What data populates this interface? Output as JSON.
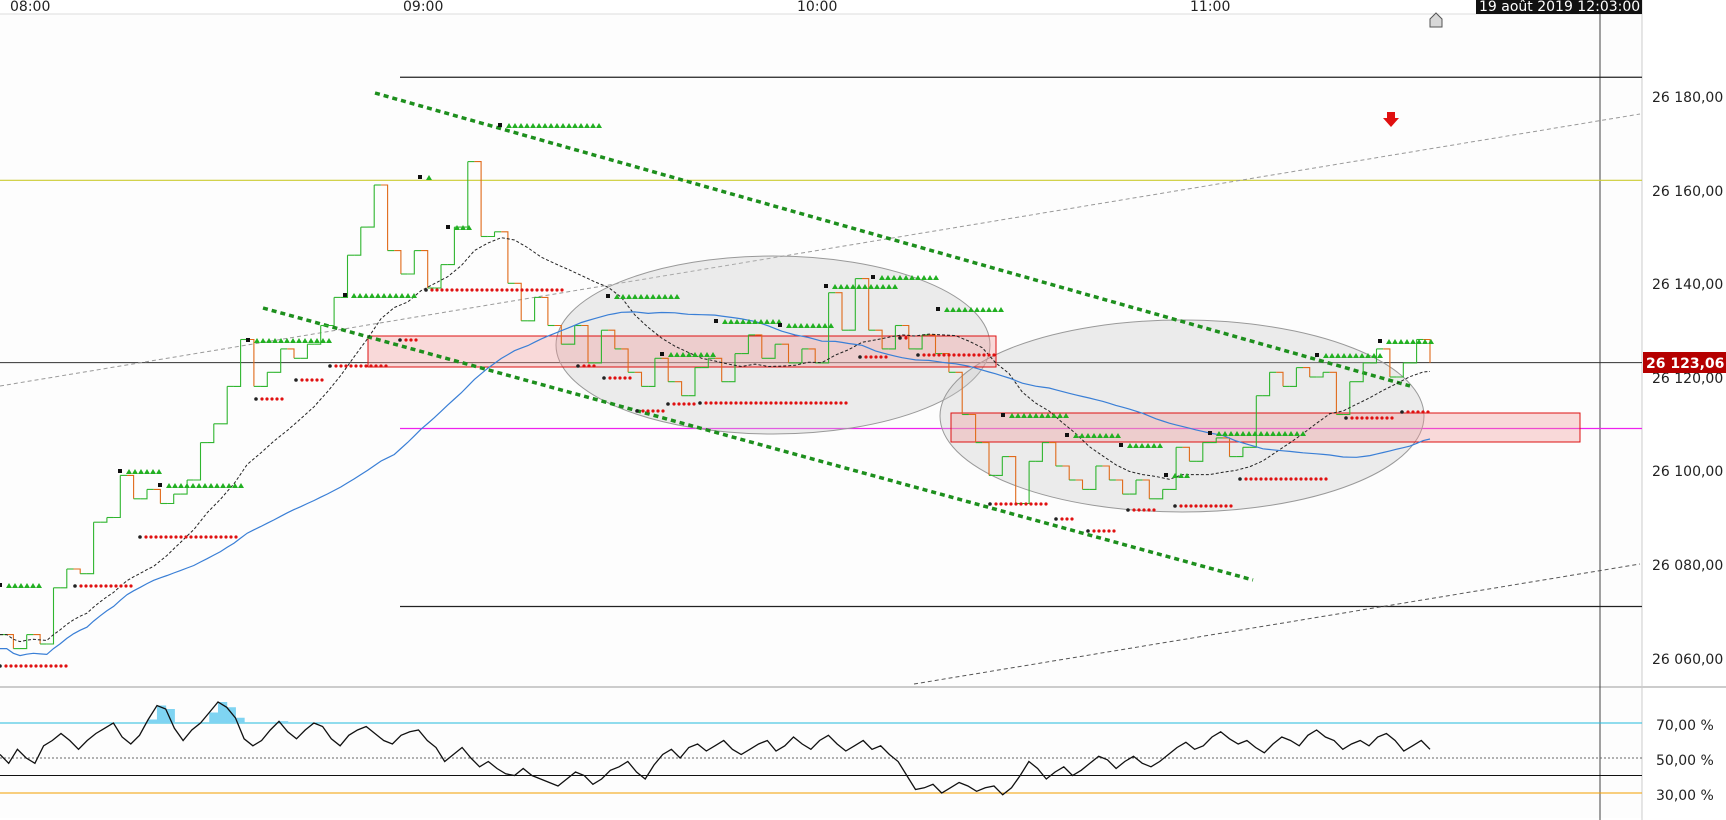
{
  "chart_data": [
    {
      "type": "line",
      "subtype": "step-price",
      "x_ticks": [
        "08:00",
        "09:00",
        "10:00",
        "11:00"
      ],
      "datetime_label": "19 août 2019 12:03:00",
      "last_price_label": "26 123,06",
      "last_price": 26123.06,
      "y_ticks": [
        {
          "value": 26180,
          "label": "26 180,00"
        },
        {
          "value": 26160,
          "label": "26 160,00"
        },
        {
          "value": 26140,
          "label": "26 140,00"
        },
        {
          "value": 26120,
          "label": "26 120,00"
        },
        {
          "value": 26100,
          "label": "26 100,00"
        },
        {
          "value": 26080,
          "label": "26 080,00"
        },
        {
          "value": 26060,
          "label": "26 060,00"
        }
      ],
      "ylim": [
        26054,
        26197
      ],
      "grid": false,
      "horizontal_levels": [
        {
          "value": 26184,
          "color": "#222222"
        },
        {
          "value": 26162,
          "color": "#cccc33"
        },
        {
          "value": 26109,
          "color": "#ee22ee"
        },
        {
          "value": 26071,
          "color": "#222222"
        }
      ],
      "price_steps": [
        26065,
        26065,
        26062,
        26062,
        26065,
        26065,
        26063,
        26063,
        26075,
        26075,
        26079,
        26079,
        26078,
        26078,
        26089,
        26089,
        26090,
        26090,
        26099,
        26099,
        26094,
        26094,
        26096,
        26096,
        26093,
        26093,
        26095,
        26095,
        26098,
        26098,
        26106,
        26106,
        26110,
        26110,
        26118,
        26118,
        26128,
        26128,
        26118,
        26118,
        26121,
        26121,
        26126,
        26126,
        26124,
        26124,
        26127,
        26127,
        26131,
        26131,
        26137,
        26137,
        26146,
        26146,
        26152,
        26152,
        26161,
        26161,
        26147,
        26147,
        26142,
        26142,
        26147,
        26147,
        26139,
        26139,
        26144,
        26144,
        26152,
        26152,
        26166,
        26166,
        26150,
        26150,
        26151,
        26151,
        26140,
        26140,
        26132,
        26132,
        26137,
        26137,
        26131,
        26131,
        26127,
        26127,
        26131,
        26131,
        26123,
        26123,
        26130,
        26130,
        26126,
        26126,
        26121,
        26121,
        26118,
        26118,
        26124,
        26124,
        26119,
        26119,
        26116,
        26116,
        26122,
        26122,
        26124,
        26124,
        26119,
        26119,
        26125,
        26125,
        26129,
        26129,
        26124,
        26124,
        26127,
        26127,
        26123,
        26123,
        26126,
        26126,
        26123,
        26123,
        26138,
        26138,
        26130,
        26130,
        26141,
        26141,
        26130,
        26130,
        26126,
        26126,
        26131,
        26131,
        26126,
        26126,
        26129,
        26129,
        26125,
        26125,
        26121,
        26121,
        26112,
        26112,
        26106,
        26106,
        26099,
        26099,
        26103,
        26103,
        26093,
        26093,
        26102,
        26102,
        26106,
        26106,
        26101,
        26101,
        26098,
        26098,
        26096,
        26096,
        26101,
        26101,
        26098,
        26098,
        26095,
        26095,
        26098,
        26098,
        26094,
        26094,
        26096,
        26096,
        26105,
        26105,
        26102,
        26102,
        26106,
        26106,
        26107,
        26107,
        26103,
        26103,
        26105,
        26105,
        26116,
        26116,
        26121,
        26121,
        26118,
        26118,
        26122,
        26122,
        26120,
        26120,
        26121,
        26121,
        26112,
        26112,
        26119,
        26119,
        26123,
        26123,
        26126,
        26126,
        26120,
        26120,
        26123,
        26123,
        26128,
        26128,
        26123
      ],
      "overlays": [
        "moving-average-black-dashed",
        "moving-average-blue",
        "dotted-green-channel",
        "red-support-zones",
        "gray-ellipses",
        "gray-dashed-trendlines",
        "red-down-arrow"
      ]
    },
    {
      "type": "line",
      "subtype": "oscillator",
      "y_ticks": [
        {
          "value": 70,
          "label": "70,00 %"
        },
        {
          "value": 50,
          "label": "50,00 %"
        },
        {
          "value": 30,
          "label": "30,00 %"
        }
      ],
      "ylim": [
        20,
        90
      ],
      "levels": [
        {
          "value": 70,
          "color": "#22bbdd"
        },
        {
          "value": 50,
          "color": "#666666"
        },
        {
          "value": 40,
          "color": "#111111"
        },
        {
          "value": 30,
          "color": "#f4a000"
        }
      ],
      "values": [
        52,
        47,
        55,
        50,
        47,
        57,
        60,
        64,
        60,
        55,
        60,
        64,
        67,
        70,
        62,
        58,
        63,
        72,
        80,
        78,
        67,
        60,
        66,
        70,
        76,
        82,
        79,
        73,
        61,
        57,
        60,
        66,
        71,
        65,
        61,
        66,
        70,
        68,
        61,
        57,
        63,
        66,
        68,
        64,
        60,
        58,
        63,
        65,
        66,
        60,
        56,
        48,
        52,
        56,
        50,
        45,
        48,
        44,
        41,
        40,
        44,
        40,
        38,
        36,
        34,
        38,
        42,
        40,
        35,
        38,
        43,
        45,
        48,
        42,
        38,
        46,
        52,
        55,
        50,
        56,
        58,
        54,
        57,
        60,
        55,
        52,
        55,
        58,
        60,
        54,
        57,
        62,
        58,
        55,
        60,
        63,
        58,
        54,
        57,
        60,
        55,
        57,
        52,
        48,
        40,
        32,
        33,
        35,
        30,
        33,
        36,
        34,
        31,
        33,
        34,
        29,
        33,
        40,
        48,
        44,
        38,
        42,
        45,
        40,
        43,
        47,
        51,
        49,
        44,
        48,
        51,
        47,
        45,
        48,
        52,
        56,
        59,
        55,
        57,
        62,
        65,
        61,
        58,
        60,
        56,
        53,
        58,
        62,
        60,
        57,
        63,
        66,
        62,
        60,
        55,
        58,
        60,
        57,
        62,
        64,
        60,
        54,
        57,
        60,
        55
      ]
    }
  ]
}
